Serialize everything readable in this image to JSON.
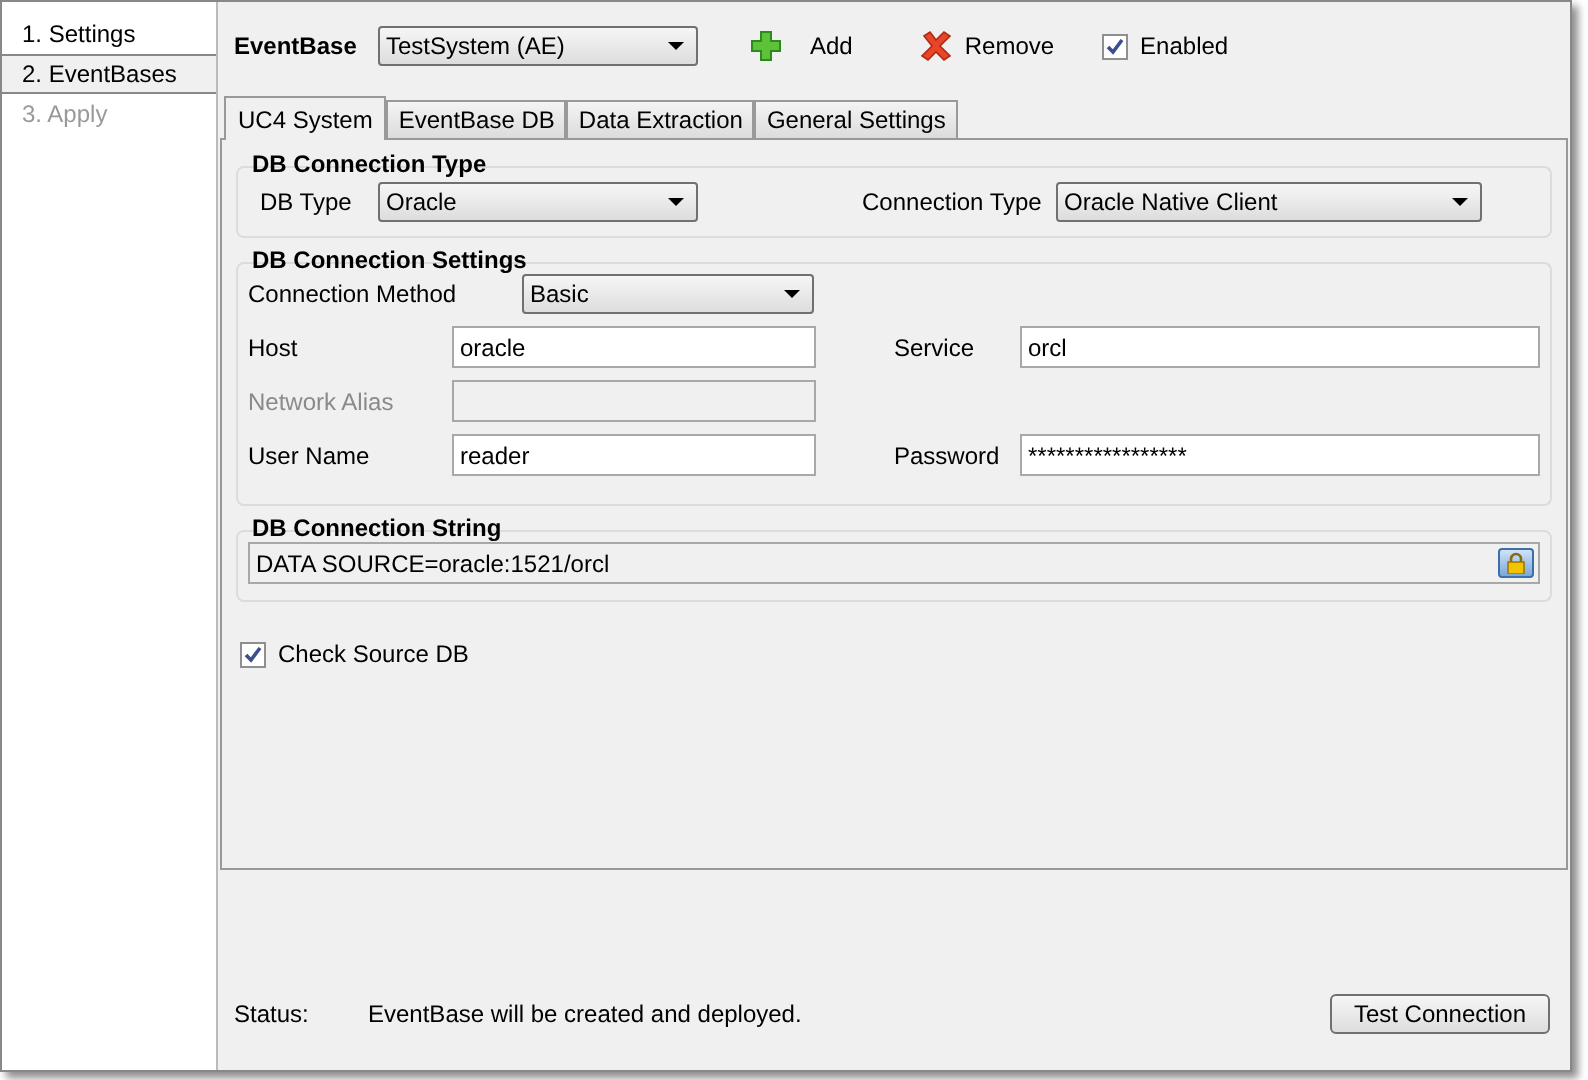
{
  "steps": [
    {
      "label": "1. Settings",
      "selected": false,
      "disabled": false
    },
    {
      "label": "2. EventBases",
      "selected": true,
      "disabled": false
    },
    {
      "label": "3. Apply",
      "selected": false,
      "disabled": true
    }
  ],
  "header": {
    "label": "EventBase",
    "dropdown": "TestSystem (AE)",
    "add": "Add",
    "remove": "Remove",
    "enabled": {
      "label": "Enabled",
      "checked": true
    }
  },
  "tabs": [
    {
      "label": "UC4 System",
      "selected": true
    },
    {
      "label": "EventBase DB",
      "selected": false
    },
    {
      "label": "Data Extraction",
      "selected": false
    },
    {
      "label": "General Settings",
      "selected": false
    }
  ],
  "connection_type": {
    "title": "DB Connection Type",
    "fields": [
      {
        "label": "DB Type",
        "value": "Oracle"
      },
      {
        "label": "Connection Type",
        "value": "Oracle Native Client"
      }
    ]
  },
  "connection_settings": {
    "title": "DB Connection Settings",
    "method": {
      "label": "Connection Method",
      "value": "Basic"
    },
    "rows": [
      [
        {
          "label": "Host",
          "value": "oracle",
          "disabled": false
        },
        {
          "label": "Service",
          "value": "orcl",
          "disabled": false
        }
      ],
      [
        {
          "label": "Network Alias",
          "disabled": true
        }
      ],
      [
        {
          "label": "User Name",
          "value": "reader",
          "disabled": false
        },
        {
          "label": "Password",
          "value": "*****************",
          "disabled": false
        }
      ]
    ]
  },
  "connection_string": {
    "title": "DB Connection String",
    "value": "DATA SOURCE=oracle:1521/orcl"
  },
  "check_source": {
    "label": "Check Source DB",
    "checked": true
  },
  "status_bar": {
    "label": "Status:",
    "message": "EventBase will be created and deployed.",
    "button": "Test Connection"
  }
}
